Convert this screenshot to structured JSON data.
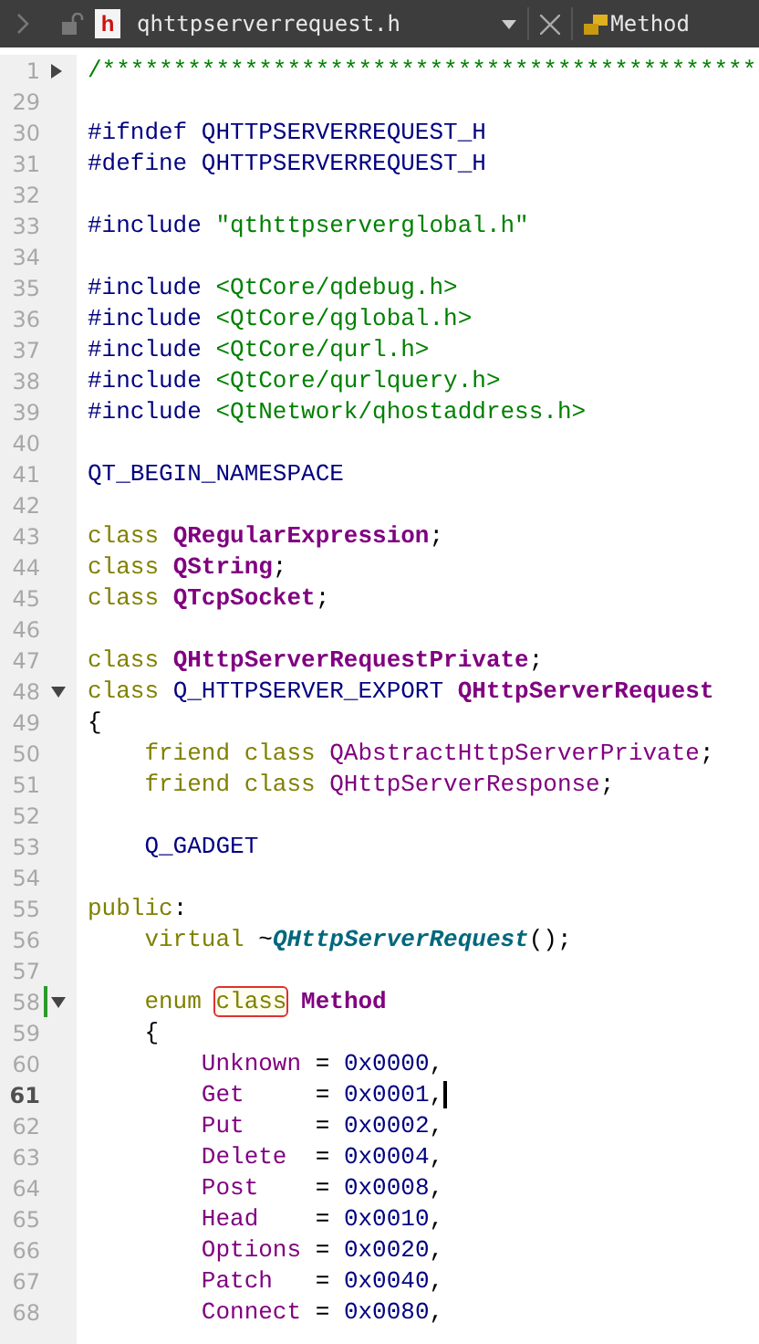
{
  "toolbar": {
    "file_badge": "h",
    "file_name": "qhttpserverrequest.h",
    "symbol": "Method"
  },
  "lines": [
    {
      "number": "1",
      "expanded": false,
      "tokens": [
        {
          "kind": "comment",
          "text": "/**********************************************"
        }
      ]
    },
    {
      "number": "29"
    },
    {
      "number": "30",
      "tokens": [
        {
          "kind": "macro",
          "text": "#ifndef QHTTPSERVERREQUEST_H"
        }
      ]
    },
    {
      "number": "31",
      "tokens": [
        {
          "kind": "macro",
          "text": "#define QHTTPSERVERREQUEST_H"
        }
      ]
    },
    {
      "number": "32"
    },
    {
      "number": "33",
      "tokens": [
        {
          "kind": "macro",
          "text": "#include "
        },
        {
          "kind": "string",
          "text": "\"qthttpserverglobal.h\""
        }
      ]
    },
    {
      "number": "34"
    },
    {
      "number": "35",
      "tokens": [
        {
          "kind": "macro",
          "text": "#include "
        },
        {
          "kind": "string",
          "text": "<QtCore/qdebug.h>"
        }
      ]
    },
    {
      "number": "36",
      "tokens": [
        {
          "kind": "macro",
          "text": "#include "
        },
        {
          "kind": "string",
          "text": "<QtCore/qglobal.h>"
        }
      ]
    },
    {
      "number": "37",
      "tokens": [
        {
          "kind": "macro",
          "text": "#include "
        },
        {
          "kind": "string",
          "text": "<QtCore/qurl.h>"
        }
      ]
    },
    {
      "number": "38",
      "tokens": [
        {
          "kind": "macro",
          "text": "#include "
        },
        {
          "kind": "string",
          "text": "<QtCore/qurlquery.h>"
        }
      ]
    },
    {
      "number": "39",
      "tokens": [
        {
          "kind": "macro",
          "text": "#include "
        },
        {
          "kind": "string",
          "text": "<QtNetwork/qhostaddress.h>"
        }
      ]
    },
    {
      "number": "40"
    },
    {
      "number": "41",
      "tokens": [
        {
          "kind": "macro",
          "text": "QT_BEGIN_NAMESPACE"
        }
      ]
    },
    {
      "number": "42"
    },
    {
      "number": "43",
      "tokens": [
        {
          "kind": "keyword",
          "text": "class "
        },
        {
          "kind": "type",
          "text": "QRegularExpression"
        },
        {
          "kind": "plain",
          "text": ";"
        }
      ]
    },
    {
      "number": "44",
      "tokens": [
        {
          "kind": "keyword",
          "text": "class "
        },
        {
          "kind": "type",
          "text": "QString"
        },
        {
          "kind": "plain",
          "text": ";"
        }
      ]
    },
    {
      "number": "45",
      "tokens": [
        {
          "kind": "keyword",
          "text": "class "
        },
        {
          "kind": "type",
          "text": "QTcpSocket"
        },
        {
          "kind": "plain",
          "text": ";"
        }
      ]
    },
    {
      "number": "46"
    },
    {
      "number": "47",
      "tokens": [
        {
          "kind": "keyword",
          "text": "class "
        },
        {
          "kind": "type",
          "text": "QHttpServerRequestPrivate"
        },
        {
          "kind": "plain",
          "text": ";"
        }
      ]
    },
    {
      "number": "48",
      "expanded": true,
      "tokens": [
        {
          "kind": "keyword",
          "text": "class "
        },
        {
          "kind": "macro",
          "text": "Q_HTTPSERVER_EXPORT "
        },
        {
          "kind": "type",
          "text": "QHttpServerRequest"
        }
      ]
    },
    {
      "number": "49",
      "tokens": [
        {
          "kind": "plain",
          "text": "{"
        }
      ]
    },
    {
      "number": "50",
      "tokens": [
        {
          "kind": "keyword",
          "text": "    friend class "
        },
        {
          "kind": "enumerator",
          "text": "QAbstractHttpServerPrivate"
        },
        {
          "kind": "plain",
          "text": ";"
        }
      ]
    },
    {
      "number": "51",
      "tokens": [
        {
          "kind": "keyword",
          "text": "    friend class "
        },
        {
          "kind": "enumerator",
          "text": "QHttpServerResponse"
        },
        {
          "kind": "plain",
          "text": ";"
        }
      ]
    },
    {
      "number": "52"
    },
    {
      "number": "53",
      "tokens": [
        {
          "kind": "macro",
          "text": "    Q_GADGET"
        }
      ]
    },
    {
      "number": "54"
    },
    {
      "number": "55",
      "tokens": [
        {
          "kind": "keyword",
          "text": "public"
        },
        {
          "kind": "plain",
          "text": ":"
        }
      ]
    },
    {
      "number": "56",
      "tokens": [
        {
          "kind": "keyword",
          "text": "    virtual "
        },
        {
          "kind": "plain",
          "text": "~"
        },
        {
          "kind": "function",
          "text": "QHttpServerRequest"
        },
        {
          "kind": "plain",
          "text": "();"
        }
      ]
    },
    {
      "number": "57"
    },
    {
      "number": "58",
      "expanded": true,
      "changed": true,
      "tokens": [
        {
          "kind": "keyword",
          "text": "    enum "
        },
        {
          "kind": "keyword",
          "text": "class",
          "highlighted": true
        },
        {
          "kind": "type",
          "text": " Method"
        }
      ]
    },
    {
      "number": "59",
      "tokens": [
        {
          "kind": "plain",
          "text": "    {"
        }
      ]
    },
    {
      "number": "60",
      "tokens": [
        {
          "kind": "enumerator",
          "text": "        Unknown "
        },
        {
          "kind": "plain",
          "text": "= "
        },
        {
          "kind": "number",
          "text": "0x0000"
        },
        {
          "kind": "plain",
          "text": ","
        }
      ]
    },
    {
      "number": "61",
      "current": true,
      "tokens": [
        {
          "kind": "enumerator",
          "text": "        Get     "
        },
        {
          "kind": "plain",
          "text": "= "
        },
        {
          "kind": "number",
          "text": "0x0001"
        },
        {
          "kind": "plain",
          "text": ","
        }
      ]
    },
    {
      "number": "62",
      "tokens": [
        {
          "kind": "enumerator",
          "text": "        Put     "
        },
        {
          "kind": "plain",
          "text": "= "
        },
        {
          "kind": "number",
          "text": "0x0002"
        },
        {
          "kind": "plain",
          "text": ","
        }
      ]
    },
    {
      "number": "63",
      "tokens": [
        {
          "kind": "enumerator",
          "text": "        Delete  "
        },
        {
          "kind": "plain",
          "text": "= "
        },
        {
          "kind": "number",
          "text": "0x0004"
        },
        {
          "kind": "plain",
          "text": ","
        }
      ]
    },
    {
      "number": "64",
      "tokens": [
        {
          "kind": "enumerator",
          "text": "        Post    "
        },
        {
          "kind": "plain",
          "text": "= "
        },
        {
          "kind": "number",
          "text": "0x0008"
        },
        {
          "kind": "plain",
          "text": ","
        }
      ]
    },
    {
      "number": "65",
      "tokens": [
        {
          "kind": "enumerator",
          "text": "        Head    "
        },
        {
          "kind": "plain",
          "text": "= "
        },
        {
          "kind": "number",
          "text": "0x0010"
        },
        {
          "kind": "plain",
          "text": ","
        }
      ]
    },
    {
      "number": "66",
      "tokens": [
        {
          "kind": "enumerator",
          "text": "        Options "
        },
        {
          "kind": "plain",
          "text": "= "
        },
        {
          "kind": "number",
          "text": "0x0020"
        },
        {
          "kind": "plain",
          "text": ","
        }
      ]
    },
    {
      "number": "67",
      "tokens": [
        {
          "kind": "enumerator",
          "text": "        Patch   "
        },
        {
          "kind": "plain",
          "text": "= "
        },
        {
          "kind": "number",
          "text": "0x0040"
        },
        {
          "kind": "plain",
          "text": ","
        }
      ]
    },
    {
      "number": "68",
      "tokens": [
        {
          "kind": "enumerator",
          "text": "        Connect "
        },
        {
          "kind": "plain",
          "text": "= "
        },
        {
          "kind": "number",
          "text": "0x0080"
        },
        {
          "kind": "plain",
          "text": ","
        }
      ]
    }
  ]
}
